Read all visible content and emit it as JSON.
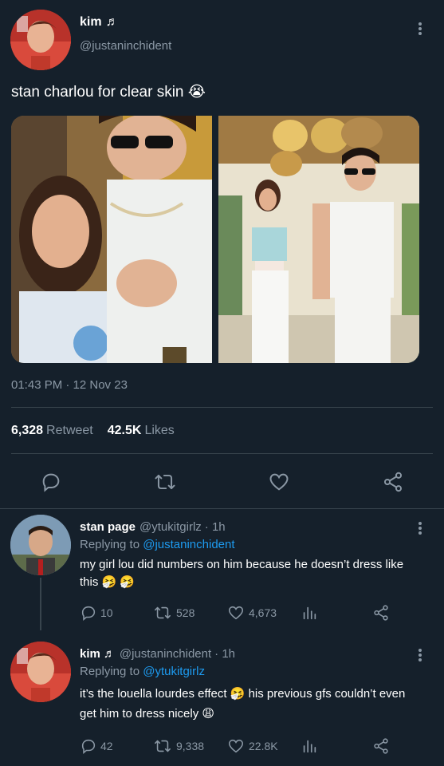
{
  "tweet": {
    "author_name": "kim",
    "author_name_glyph": "♬",
    "author_handle": "@justaninchident",
    "text": "stan charlou for clear skin 😭",
    "timestamp": "01:43 PM · 12 Nov 23",
    "retweet_count": "6,328",
    "retweet_label": "Retweet",
    "likes_count": "42.5K",
    "likes_label": "Likes"
  },
  "actions": {
    "reply_icon": "reply-icon",
    "retweet_icon": "retweet-icon",
    "like_icon": "heart-icon",
    "share_icon": "share-icon"
  },
  "replies": [
    {
      "name": "stan page",
      "handle": "@ytukitgirlz",
      "time": "· 1h",
      "replying_prefix": "Replying to",
      "replying_to": "@justaninchident",
      "text_line1": "my girl lou did numbers on him because he doesn’t dress like",
      "text_line2": "this 🤧 🤧",
      "reply_count": "10",
      "retweet_count": "528",
      "like_count": "4,673"
    },
    {
      "name": "kim",
      "name_glyph": "♬",
      "handle": "@justaninchident",
      "time": "· 1h",
      "replying_prefix": "Replying to",
      "replying_to": "@ytukitgirlz",
      "text_line1": "it’s the louella lourdes effect 🤧  his previous gfs couldn’t even",
      "text_line2": "get him to dress nicely 😩",
      "reply_count": "42",
      "retweet_count": "9,338",
      "like_count": "22.8K"
    }
  ],
  "colors": {
    "background": "#15202b",
    "text_secondary": "#8b98a5",
    "link": "#1d9bf0",
    "divider": "#38444d"
  }
}
